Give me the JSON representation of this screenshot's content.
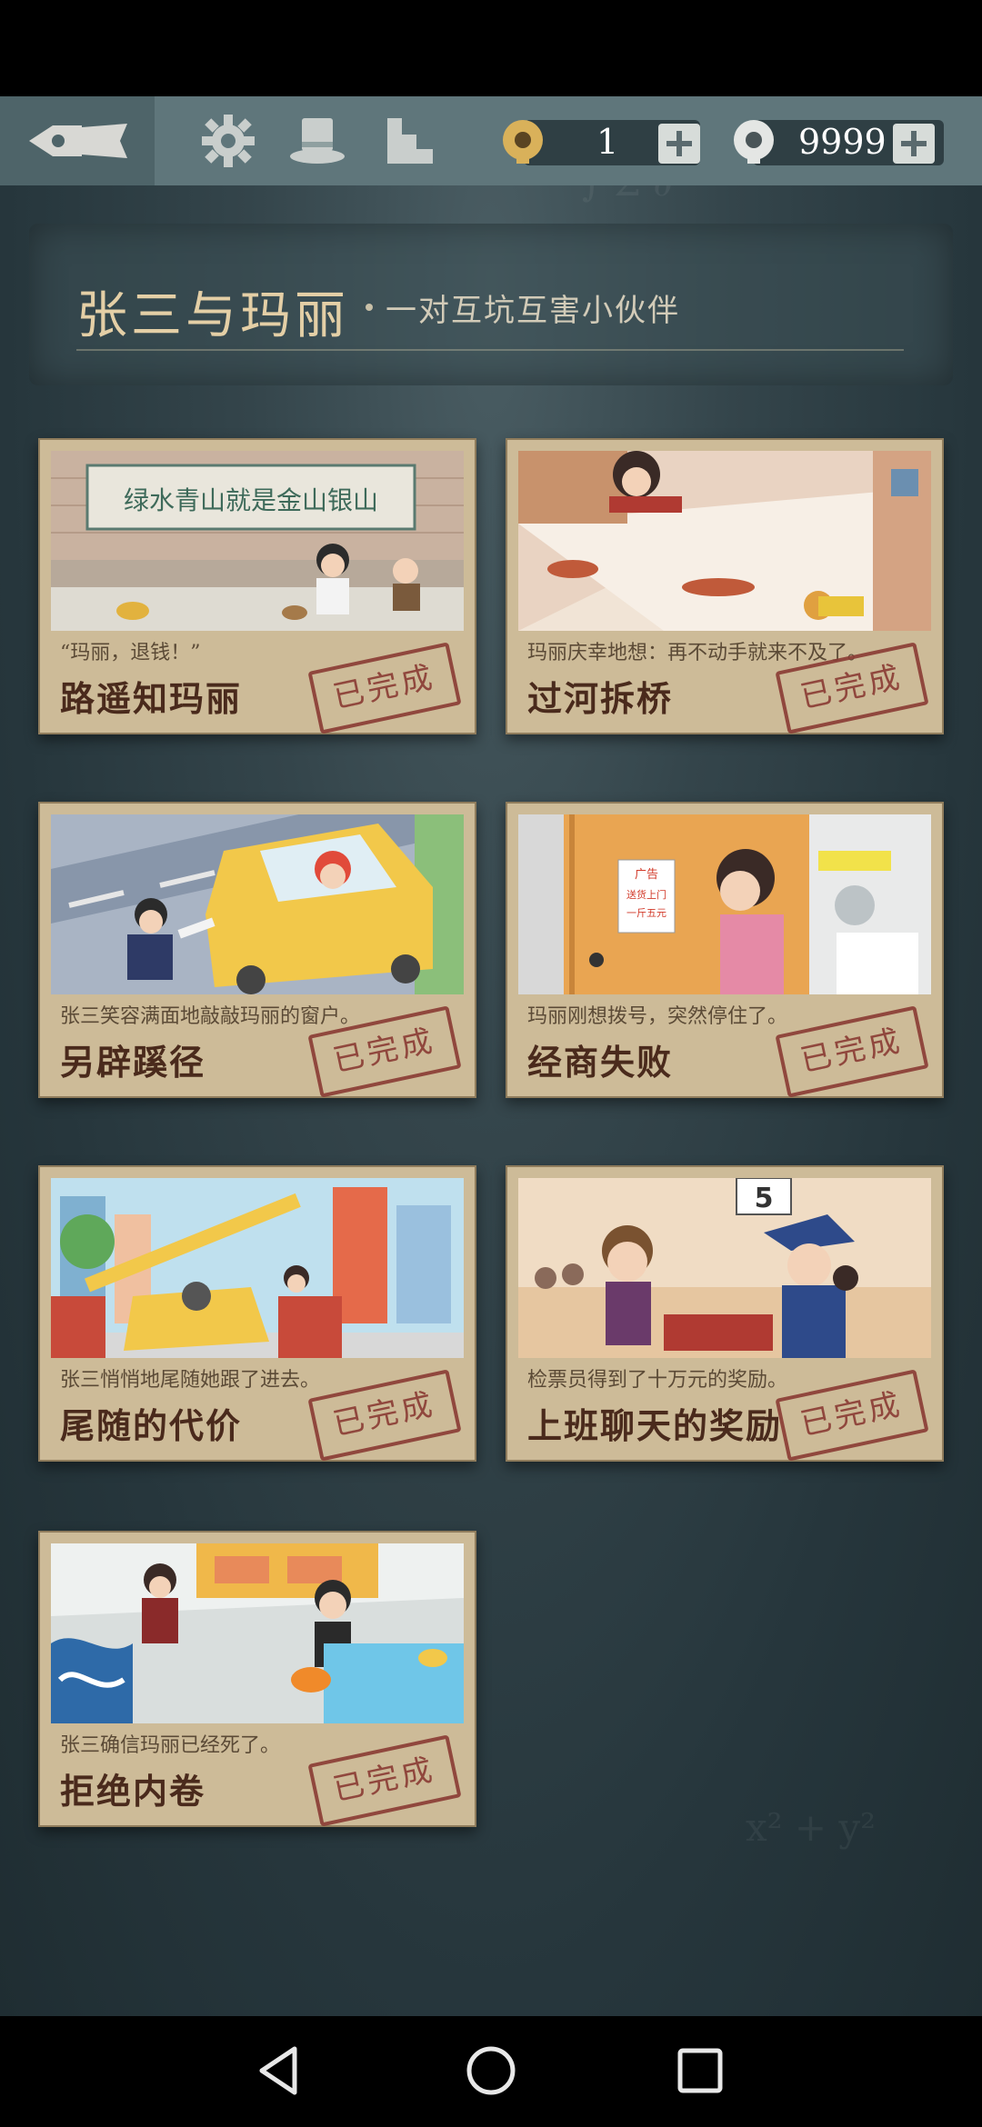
{
  "header": {
    "keys_count": "1",
    "coins_count": "9999"
  },
  "chapter": {
    "title": "张三与玛丽",
    "subtitle": "一对互坑互害小伙伴"
  },
  "cards": [
    {
      "caption": "“玛丽，退钱！”",
      "title": "路遥知玛丽",
      "status": "已完成",
      "banner": "绿水青山就是金山银山"
    },
    {
      "caption": "玛丽庆幸地想：再不动手就来不及了。",
      "title": "过河拆桥",
      "status": "已完成"
    },
    {
      "caption": "张三笑容满面地敲敲玛丽的窗户。",
      "title": "另辟蹊径",
      "status": "已完成"
    },
    {
      "caption": "玛丽刚想拨号，突然停住了。",
      "title": "经商失败",
      "status": "已完成",
      "poster": [
        "广告",
        "送货上门",
        "一斤五元"
      ]
    },
    {
      "caption": "张三悄悄地尾随她跟了进去。",
      "title": "尾随的代价",
      "status": "已完成"
    },
    {
      "caption": "检票员得到了十万元的奖励。",
      "title": "上班聊天的奖励",
      "status": "已完成",
      "sign": "5"
    },
    {
      "caption": "张三确信玛丽已经死了。",
      "title": "拒绝内卷",
      "status": "已完成"
    }
  ]
}
